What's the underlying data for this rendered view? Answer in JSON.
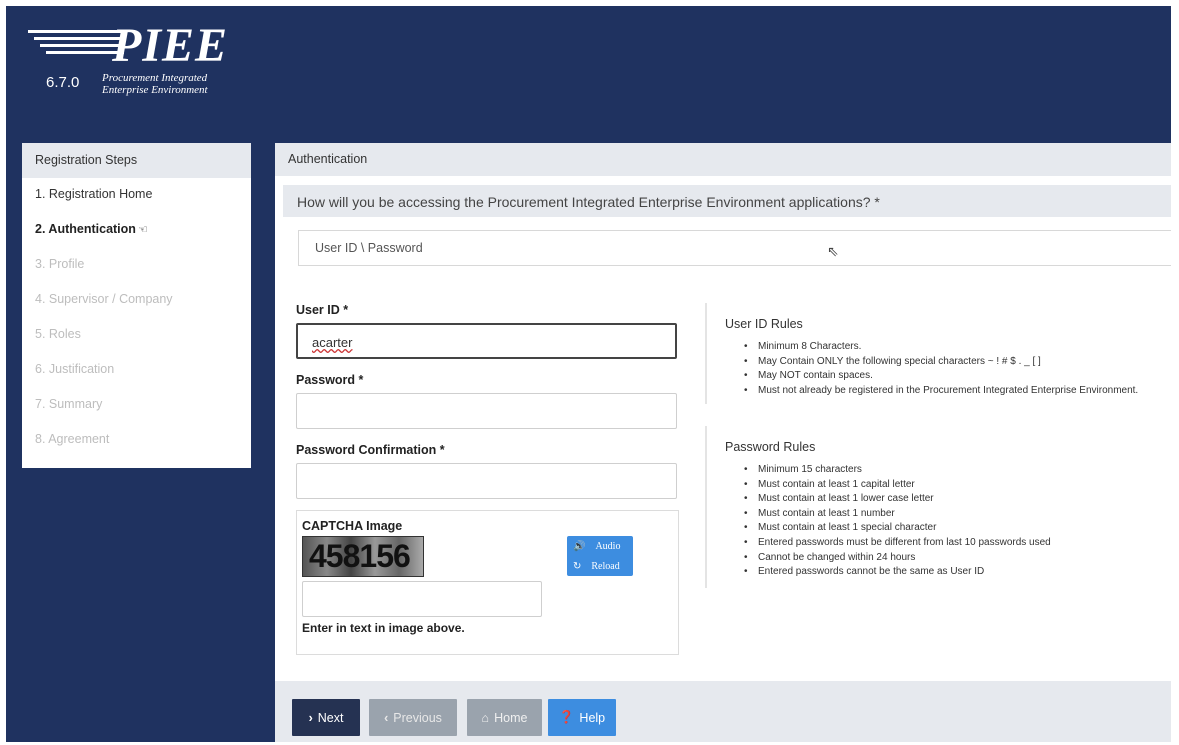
{
  "header": {
    "logo_text": "PIEE",
    "version": "6.7.0",
    "tagline_line1": "Procurement Integrated",
    "tagline_line2": "Enterprise Environment"
  },
  "sidebar": {
    "title": "Registration Steps",
    "steps": [
      {
        "label": "1. Registration Home",
        "state": "done"
      },
      {
        "label": "2. Authentication",
        "state": "active"
      },
      {
        "label": "3. Profile",
        "state": "todo"
      },
      {
        "label": "4. Supervisor / Company",
        "state": "todo"
      },
      {
        "label": "5. Roles",
        "state": "todo"
      },
      {
        "label": "6. Justification",
        "state": "todo"
      },
      {
        "label": "7. Summary",
        "state": "todo"
      },
      {
        "label": "8. Agreement",
        "state": "todo"
      }
    ]
  },
  "main": {
    "title": "Authentication",
    "question": "How will you be accessing the Procurement Integrated Enterprise Environment applications? *",
    "access_method": "User ID \\ Password"
  },
  "form": {
    "userid_label": "User ID *",
    "userid_value": "acarter",
    "password_label": "Password *",
    "password_confirm_label": "Password Confirmation *",
    "captcha_label": "CAPTCHA Image",
    "captcha_text": "458156",
    "captcha_audio": "Audio",
    "captcha_reload": "Reload",
    "captcha_help": "Enter in text in image above."
  },
  "userid_rules": {
    "title": "User ID Rules",
    "items": [
      "Minimum 8 Characters.",
      "May Contain ONLY the following special characters ~ ! # $ . _ [ ]",
      "May NOT contain spaces.",
      "Must not already be registered in the Procurement Integrated Enterprise Environment."
    ]
  },
  "password_rules": {
    "title": "Password Rules",
    "items": [
      "Minimum 15 characters",
      "Must contain at least 1 capital letter",
      "Must contain at least 1 lower case letter",
      "Must contain at least 1 number",
      "Must contain at least 1 special character",
      "Entered passwords must be different from last 10 passwords used",
      "Cannot be changed within 24 hours",
      "Entered passwords cannot be the same as User ID"
    ]
  },
  "footer": {
    "next": "Next",
    "previous": "Previous",
    "home": "Home",
    "help": "Help"
  },
  "colors": {
    "navy": "#1f3260",
    "accent_blue": "#3d8de0",
    "next_button": "#253252",
    "disabled_button": "#9aa3ad"
  }
}
